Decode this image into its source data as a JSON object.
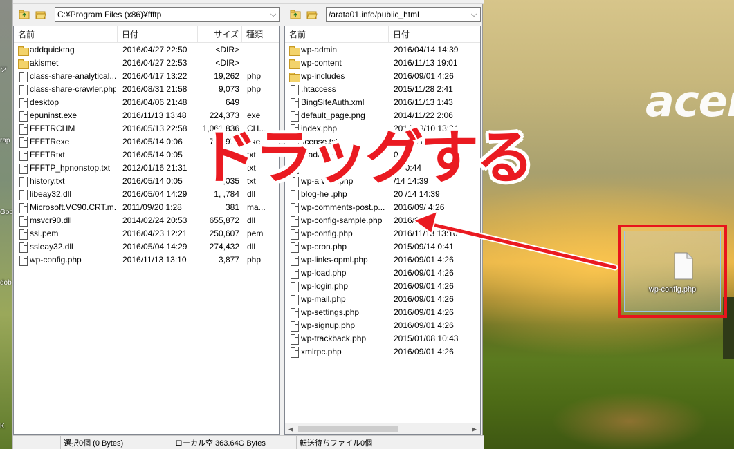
{
  "desktop": {
    "brand_logo_text": "acer",
    "left_glyphs": [
      "ツ",
      "rap",
      "Goo",
      "dob",
      "K"
    ],
    "dragged_file": {
      "label": "wp-config.php",
      "frame_color": "#e8141c"
    }
  },
  "annotation": {
    "text": "ドラッグする",
    "color": "#ea1a21"
  },
  "local_pane": {
    "path": "C:¥Program Files (x86)¥ffftp",
    "columns": [
      "名前",
      "日付",
      "サイズ",
      "種類"
    ],
    "files": [
      {
        "icon": "folder",
        "name": "addquicktag",
        "date": "2016/04/27 22:50",
        "size": "<DIR>",
        "type": ""
      },
      {
        "icon": "folder",
        "name": "akismet",
        "date": "2016/04/27 22:53",
        "size": "<DIR>",
        "type": ""
      },
      {
        "icon": "file",
        "name": "class-share-analytical....",
        "date": "2016/04/17 13:22",
        "size": "19,262",
        "type": "php"
      },
      {
        "icon": "file",
        "name": "class-share-crawler.php",
        "date": "2016/08/31 21:58",
        "size": "9,073",
        "type": "php"
      },
      {
        "icon": "file",
        "name": "desktop",
        "date": "2016/04/06 21:48",
        "size": "649",
        "type": ""
      },
      {
        "icon": "file",
        "name": "epuninst.exe",
        "date": "2016/11/13 13:48",
        "size": "224,373",
        "type": "exe"
      },
      {
        "icon": "file",
        "name": "FFFTRCHM",
        "date": "2016/05/13 22:58",
        "size": "1,061,836",
        "type": "CH..."
      },
      {
        "icon": "file",
        "name": "FFFTRexe",
        "date": "2016/05/14 0:06",
        "size": "702,976",
        "type": "exe"
      },
      {
        "icon": "file",
        "name": "FFFTRtxt",
        "date": "2016/05/14 0:05",
        "size": "2,97",
        "type": "txt"
      },
      {
        "icon": "file",
        "name": "FFFTP_hpnonstop.txt",
        "date": "2012/01/16 21:31",
        "size": "",
        "type": "txt"
      },
      {
        "icon": "file",
        "name": "history.txt",
        "date": "2016/05/14 0:05",
        "size": "2,035",
        "type": "txt"
      },
      {
        "icon": "file",
        "name": "libeay32.dll",
        "date": "2016/05/04 14:29",
        "size": "1,   ,784",
        "type": "dll"
      },
      {
        "icon": "file",
        "name": "Microsoft.VC90.CRT.m...",
        "date": "2011/09/20 1:28",
        "size": "381",
        "type": "ma..."
      },
      {
        "icon": "file",
        "name": "msvcr90.dll",
        "date": "2014/02/24 20:53",
        "size": "655,872",
        "type": "dll"
      },
      {
        "icon": "file",
        "name": "ssl.pem",
        "date": "2016/04/23 12:21",
        "size": "250,607",
        "type": "pem"
      },
      {
        "icon": "file",
        "name": "ssleay32.dll",
        "date": "2016/05/04 14:29",
        "size": "274,432",
        "type": "dll"
      },
      {
        "icon": "file",
        "name": "wp-config.php",
        "date": "2016/11/13 13:10",
        "size": "3,877",
        "type": "php"
      }
    ]
  },
  "remote_pane": {
    "path": "/arata01.info/public_html",
    "columns": [
      "名前",
      "日付"
    ],
    "files": [
      {
        "icon": "folder",
        "name": "wp-admin",
        "date": "2016/04/14 14:39"
      },
      {
        "icon": "folder",
        "name": "wp-content",
        "date": "2016/11/13 19:01"
      },
      {
        "icon": "folder",
        "name": "wp-includes",
        "date": "2016/09/01 4:26"
      },
      {
        "icon": "file",
        "name": ".htaccess",
        "date": "2015/11/28 2:41"
      },
      {
        "icon": "file",
        "name": "BingSiteAuth.xml",
        "date": "2016/11/13 1:43"
      },
      {
        "icon": "file",
        "name": "default_page.png",
        "date": "2014/11/22 2:06"
      },
      {
        "icon": "file",
        "name": "index.php",
        "date": "2014/09/10 13:34"
      },
      {
        "icon": "file",
        "name": "license.txt",
        "date": "2016/ /14 14:39"
      },
      {
        "icon": "file",
        "name": "readme-ja.h",
        "date": "0:43"
      },
      {
        "icon": "file",
        "name": "",
        "date": "17 0:44"
      },
      {
        "icon": "file",
        "name": "wp-a  vate.php",
        "date": "/14 14:39"
      },
      {
        "icon": "file",
        "name": "  blog-he  .php",
        "date": "20  /14 14:39"
      },
      {
        "icon": "file",
        "name": "wp-comments-post.p...",
        "date": "2016/09/  4:26"
      },
      {
        "icon": "file",
        "name": "wp-config-sample.php",
        "date": "2016/0"
      },
      {
        "icon": "file",
        "name": "wp-config.php",
        "date": "2016/11/13 13:10"
      },
      {
        "icon": "file",
        "name": "wp-cron.php",
        "date": "2015/09/14 0:41"
      },
      {
        "icon": "file",
        "name": "wp-links-opml.php",
        "date": "2016/09/01 4:26"
      },
      {
        "icon": "file",
        "name": "wp-load.php",
        "date": "2016/09/01 4:26"
      },
      {
        "icon": "file",
        "name": "wp-login.php",
        "date": "2016/09/01 4:26"
      },
      {
        "icon": "file",
        "name": "wp-mail.php",
        "date": "2016/09/01 4:26"
      },
      {
        "icon": "file",
        "name": "wp-settings.php",
        "date": "2016/09/01 4:26"
      },
      {
        "icon": "file",
        "name": "wp-signup.php",
        "date": "2016/09/01 4:26"
      },
      {
        "icon": "file",
        "name": "wp-trackback.php",
        "date": "2015/01/08 10:43"
      },
      {
        "icon": "file",
        "name": "xmlrpc.php",
        "date": "2016/09/01 4:26"
      }
    ]
  },
  "statusbar": {
    "selection": "選択0個 (0 Bytes)",
    "local_free": "ローカル空 363.64G Bytes",
    "queue": "転送待ちファイル0個"
  }
}
